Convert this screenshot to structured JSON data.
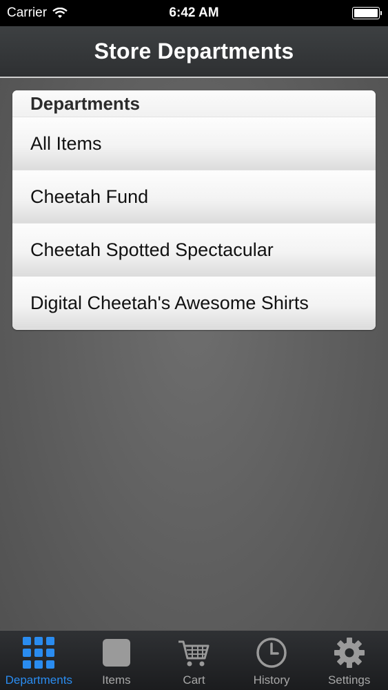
{
  "status": {
    "carrier": "Carrier",
    "time": "6:42 AM"
  },
  "nav": {
    "title": "Store Departments"
  },
  "section": {
    "header": "Departments"
  },
  "departments": [
    {
      "label": "All Items"
    },
    {
      "label": "Cheetah Fund"
    },
    {
      "label": "Cheetah Spotted Spectacular"
    },
    {
      "label": "Digital Cheetah's Awesome Shirts"
    }
  ],
  "tabs": [
    {
      "label": "Departments",
      "icon": "grid-icon",
      "active": true
    },
    {
      "label": "Items",
      "icon": "square-icon",
      "active": false
    },
    {
      "label": "Cart",
      "icon": "cart-icon",
      "active": false
    },
    {
      "label": "History",
      "icon": "clock-icon",
      "active": false
    },
    {
      "label": "Settings",
      "icon": "gear-icon",
      "active": false
    }
  ],
  "colors": {
    "accent": "#2a8cf0",
    "inactive": "#a8a8a8"
  }
}
